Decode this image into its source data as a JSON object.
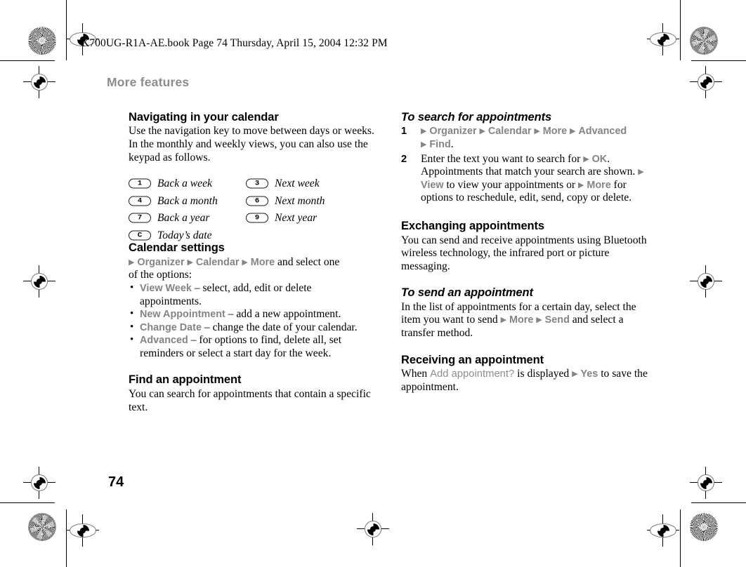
{
  "document": {
    "running_header": "K700UG-R1A-AE.book  Page 74  Thursday, April 15, 2004  12:32 PM",
    "chapter_title": "More features",
    "page_number": "74"
  },
  "colors": {
    "menu_gray": "#848484",
    "chapter_gray": "#8c8c8c",
    "body_black": "#000000"
  },
  "left_column": {
    "section1": {
      "heading": "Navigating in your calendar",
      "body": "Use the navigation key to move between days or weeks. In the monthly and weekly views, you can also use the keypad as follows."
    },
    "keypad_table": {
      "rows": [
        {
          "left_key": "1",
          "left_label": "Back a week",
          "right_key": "3",
          "right_label": "Next week"
        },
        {
          "left_key": "4",
          "left_label": "Back a month",
          "right_key": "6",
          "right_label": "Next month"
        },
        {
          "left_key": "7",
          "left_label": "Back a year",
          "right_key": "9",
          "right_label": "Next year"
        },
        {
          "left_key": "C",
          "left_label": "Today’s date",
          "right_key": "",
          "right_label": ""
        }
      ]
    },
    "section2": {
      "heading": "Calendar settings",
      "path": [
        "Organizer",
        "Calendar",
        "More"
      ],
      "path_tail": " and select one",
      "intro_line2": "of the options:",
      "bullets": [
        {
          "term": "View Week",
          "desc": " – select, add, edit or delete appointments."
        },
        {
          "term": "New Appointment",
          "desc": " – add a new appointment."
        },
        {
          "term": "Change Date",
          "desc": " – change the date of your calendar."
        },
        {
          "term": "Advanced",
          "desc": " – for options to find, delete all, set reminders or select a start day for the week."
        }
      ]
    },
    "section3": {
      "heading": "Find an appointment",
      "body": "You can search for appointments that contain a specific text."
    }
  },
  "right_column": {
    "section1": {
      "heading": "To search for appointments",
      "steps": [
        {
          "num": "1",
          "path": [
            "Organizer",
            "Calendar",
            "More",
            "Advanced",
            "Find"
          ],
          "trailing": "."
        },
        {
          "num": "2",
          "text_a": "Enter the text you want to search for ",
          "menu_a": "OK",
          "text_b": ". Appointments that match your search are shown. ",
          "menu_b": "View",
          "text_c": " to view your appointments or ",
          "menu_c": "More",
          "text_d": " for options to reschedule, edit, send, copy or delete."
        }
      ]
    },
    "section2": {
      "heading": "Exchanging appointments",
      "body": "You can send and receive appointments using Bluetooth wireless technology, the infrared port or picture messaging."
    },
    "section3": {
      "heading": "To send an appointment",
      "text_a": "In the list of appointments for a certain day, select the item you want to send ",
      "menu_a": "More",
      "menu_b": "Send",
      "text_b": " and select a transfer method."
    },
    "section4": {
      "heading": "Receiving an appointment",
      "text_a": "When ",
      "prompt": "Add appointment?",
      "text_b": " is displayed ",
      "menu_a": "Yes",
      "text_c": " to save the appointment."
    }
  },
  "icons": {
    "arrow_marker": "▶",
    "registration_mark": "registration-target",
    "burst_mark": "print-burst-target"
  }
}
